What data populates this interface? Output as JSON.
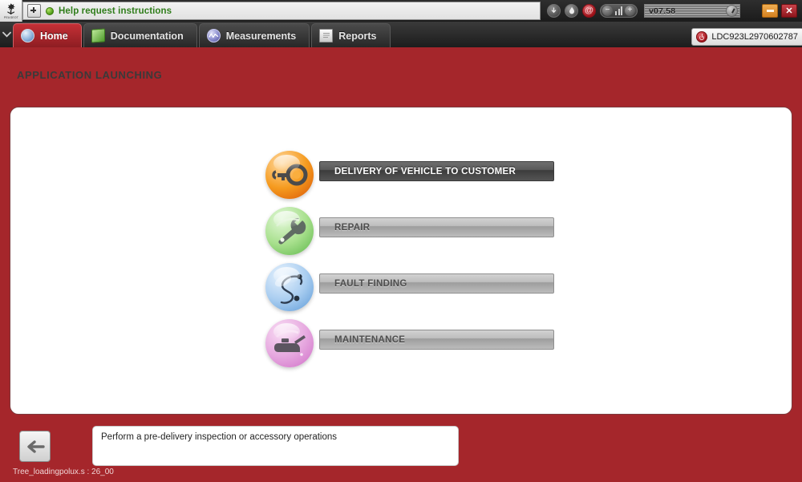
{
  "window": {
    "brand_logo": "peugeot-lion-logo",
    "title": "Help request instructions",
    "version": "v07.58",
    "tools": [
      {
        "name": "download-icon",
        "glyph": "↓"
      },
      {
        "name": "flame-icon",
        "glyph": "●"
      },
      {
        "name": "email-at-icon",
        "glyph": "@"
      }
    ],
    "volume": {
      "minus": "−",
      "plus": "+"
    },
    "minimize_label": "",
    "close_label": "✕"
  },
  "tabs": [
    {
      "label": "Home",
      "icon": "home-globe-icon",
      "active": true
    },
    {
      "label": "Documentation",
      "icon": "documentation-book-icon",
      "active": false
    },
    {
      "label": "Measurements",
      "icon": "measurements-waveform-icon",
      "active": false
    },
    {
      "label": "Reports",
      "icon": "reports-document-icon",
      "active": false
    }
  ],
  "vehicle": {
    "vin": "LDC923L2970602787",
    "power_icon": "power-icon"
  },
  "main": {
    "page_title": "APPLICATION LAUNCHING",
    "menu": [
      {
        "label": "DELIVERY OF VEHICLE TO CUSTOMER",
        "icon": "key-handover-icon",
        "orb": "orb-orange",
        "selected": true
      },
      {
        "label": "REPAIR",
        "icon": "wrench-icon",
        "orb": "orb-green",
        "selected": false
      },
      {
        "label": "FAULT FINDING",
        "icon": "stethoscope-icon",
        "orb": "orb-blue",
        "selected": false
      },
      {
        "label": "MAINTENANCE",
        "icon": "oil-can-icon",
        "orb": "orb-pink",
        "selected": false
      }
    ]
  },
  "footer": {
    "back_icon": "back-arrow-icon",
    "description": "Perform a pre-delivery inspection or accessory operations",
    "status": "Tree_loadingpolux.s : 26_00"
  },
  "colors": {
    "background_red": "#a5262b",
    "active_tab_red": "#c53036",
    "panel_border": "#7c3b3e",
    "title_green": "#2f7d1a"
  }
}
